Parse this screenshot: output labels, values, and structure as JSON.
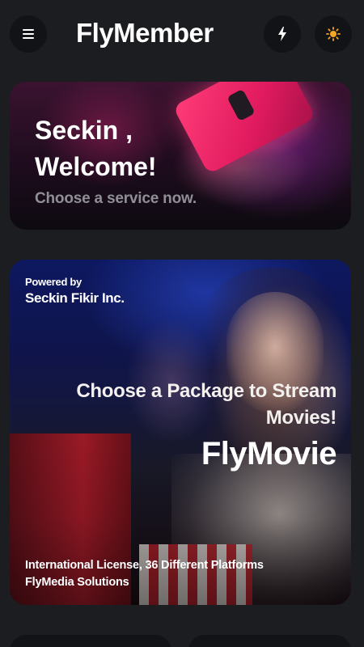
{
  "header": {
    "title": "FlyMember",
    "menu_icon": "hamburger-menu-icon",
    "flash_icon": "lightning-icon",
    "theme_icon": "sun-icon"
  },
  "welcome": {
    "name": "Seckin ,",
    "greeting": "Welcome!",
    "subtitle": "Choose a service now."
  },
  "promo": {
    "powered_by": "Powered by",
    "company": "Seckin Fikir Inc.",
    "headline": "Choose a Package to Stream Movies!",
    "brand": "FlyMovie",
    "license": "International License, 36 Different Platforms",
    "provider": "FlyMedia Solutions"
  },
  "colors": {
    "background": "#1c1d20",
    "button": "#121316",
    "accent_pink": "#ff3b78",
    "sun": "#f5a623"
  }
}
